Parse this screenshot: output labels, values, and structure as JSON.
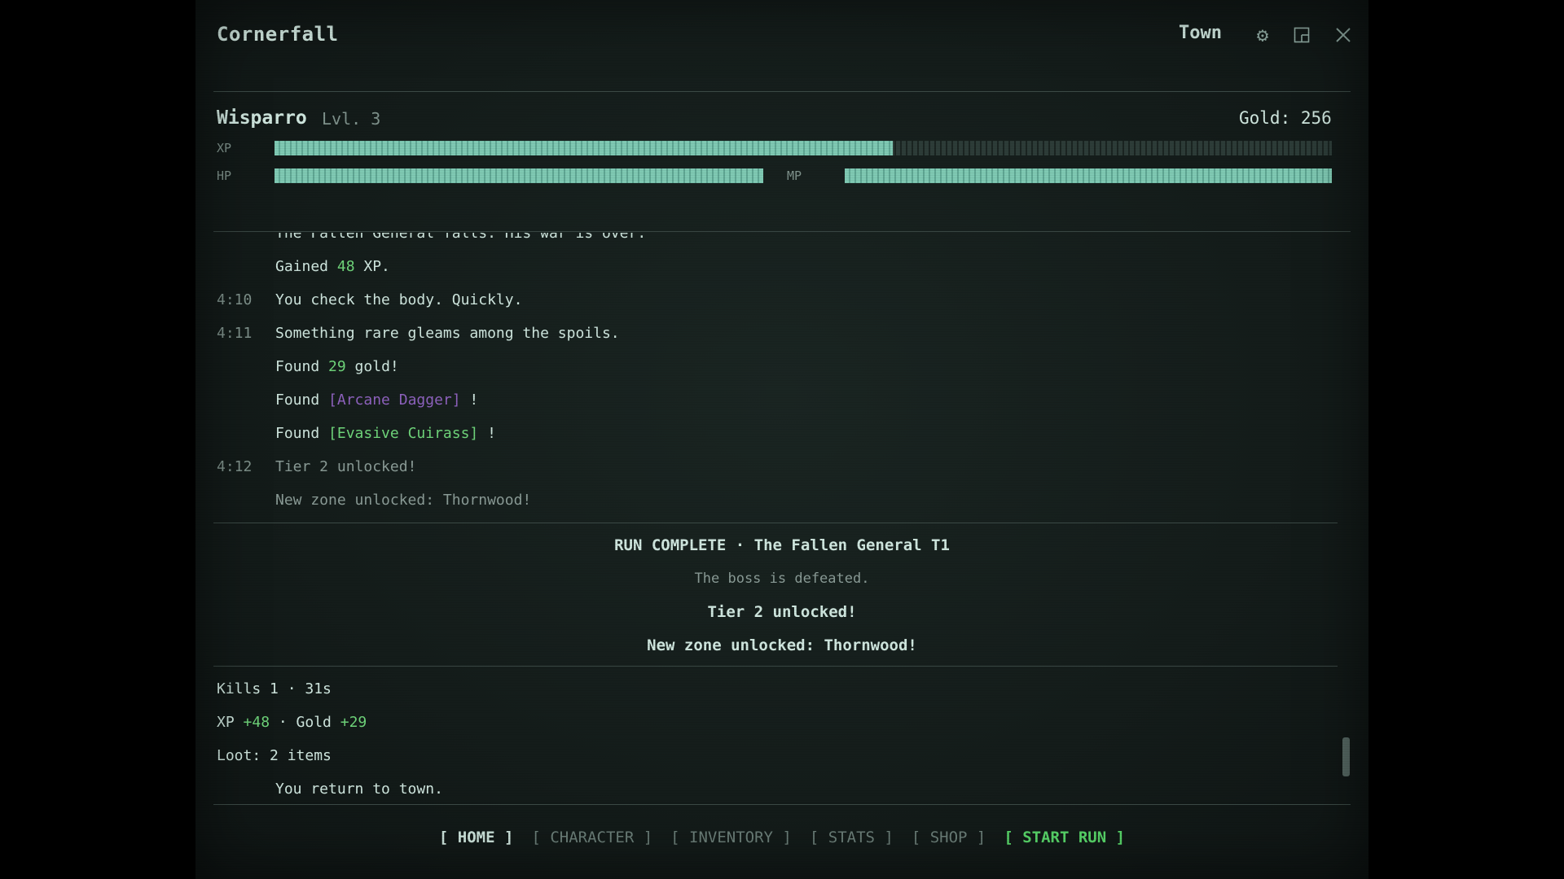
{
  "app": {
    "title": "Cornerfall",
    "location": "Town"
  },
  "icons": {
    "settings": "gear-icon",
    "window": "window-layout-icon",
    "close": "close-icon"
  },
  "character": {
    "name": "Wisparro",
    "level": "Lvl. 3",
    "gold_label": "Gold:",
    "gold_value": "256",
    "xp": {
      "label": "XP",
      "fraction": 0.585
    },
    "hp": {
      "label": "HP",
      "fraction": 1.0
    },
    "mp": {
      "label": "MP",
      "fraction": 1.0
    }
  },
  "log": [
    {
      "time": "",
      "parts": [
        {
          "text": "The Fallen General falls. His war is over.",
          "style": ""
        }
      ]
    },
    {
      "time": "",
      "parts": [
        {
          "text": "Gained ",
          "style": ""
        },
        {
          "text": "48",
          "style": "green"
        },
        {
          "text": " XP.",
          "style": ""
        }
      ]
    },
    {
      "time": "4:10",
      "parts": [
        {
          "text": "You check the body. Quickly.",
          "style": ""
        }
      ]
    },
    {
      "time": "4:11",
      "parts": [
        {
          "text": "Something rare gleams among the spoils.",
          "style": ""
        }
      ]
    },
    {
      "time": "",
      "parts": [
        {
          "text": "Found ",
          "style": ""
        },
        {
          "text": "29",
          "style": "green"
        },
        {
          "text": " gold!",
          "style": ""
        }
      ]
    },
    {
      "time": "",
      "parts": [
        {
          "text": "Found ",
          "style": ""
        },
        {
          "text": "[Arcane Dagger]",
          "style": "purple"
        },
        {
          "text": " !",
          "style": ""
        }
      ]
    },
    {
      "time": "",
      "parts": [
        {
          "text": "Found ",
          "style": ""
        },
        {
          "text": "[Evasive Cuirass]",
          "style": "green"
        },
        {
          "text": " !",
          "style": ""
        }
      ]
    },
    {
      "time": "4:12",
      "parts": [
        {
          "text": "Tier 2 unlocked!",
          "style": "dim"
        }
      ]
    },
    {
      "time": "",
      "parts": [
        {
          "text": "New zone unlocked: Thornwood!",
          "style": "dim"
        }
      ]
    }
  ],
  "summary": {
    "heading": "RUN COMPLETE · The Fallen General T1",
    "subtitle": "The boss is defeated.",
    "tier": "Tier 2 unlocked!",
    "zone": "New zone unlocked: Thornwood!"
  },
  "stats": {
    "kills": "Kills 1 · 31s",
    "xp_label": "XP ",
    "xp_value": "+48",
    "gold_label": " · Gold ",
    "gold_value": "+29",
    "loot": "Loot: 2 items",
    "return": "You return to town."
  },
  "nav": [
    {
      "label": "[ HOME ]",
      "state": "active",
      "name": "nav-home"
    },
    {
      "label": "[ CHARACTER ]",
      "state": "",
      "name": "nav-character"
    },
    {
      "label": "[ INVENTORY ]",
      "state": "",
      "name": "nav-inventory"
    },
    {
      "label": "[ STATS ]",
      "state": "",
      "name": "nav-stats"
    },
    {
      "label": "[ SHOP ]",
      "state": "",
      "name": "nav-shop"
    },
    {
      "label": "[ START RUN ]",
      "state": "start",
      "name": "nav-start-run"
    }
  ],
  "colors": {
    "accent": "#7fc9b3",
    "green": "#6fd57a",
    "purple": "#8e62be",
    "text": "#cfe6de"
  }
}
